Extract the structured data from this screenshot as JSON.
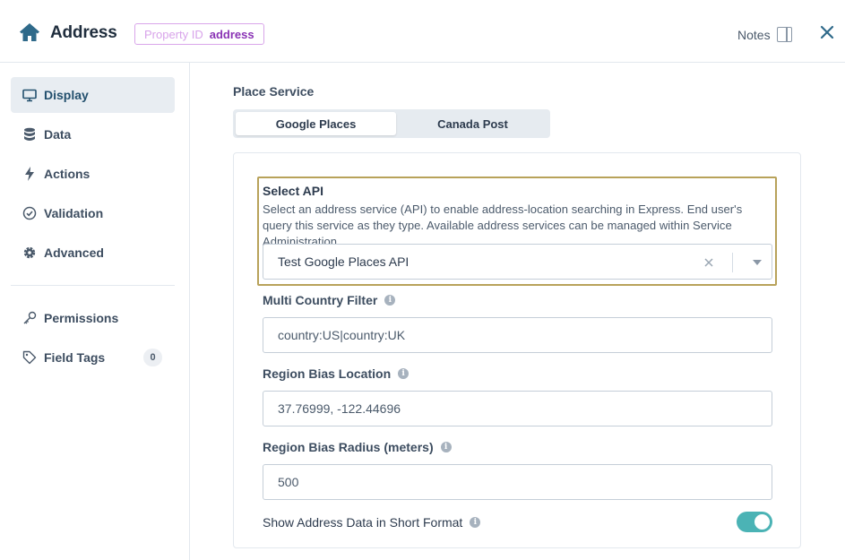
{
  "header": {
    "title": "Address",
    "property_id_label": "Property ID",
    "property_id_value": "address",
    "notes_label": "Notes"
  },
  "sidebar": {
    "items": [
      {
        "label": "Display",
        "icon": "monitor-icon",
        "active": true
      },
      {
        "label": "Data",
        "icon": "database-icon"
      },
      {
        "label": "Actions",
        "icon": "lightning-icon"
      },
      {
        "label": "Validation",
        "icon": "check-circle-icon"
      },
      {
        "label": "Advanced",
        "icon": "gear-icon"
      },
      {
        "label": "Permissions",
        "icon": "key-icon"
      },
      {
        "label": "Field Tags",
        "icon": "tag-icon",
        "count": "0"
      }
    ]
  },
  "main": {
    "place_service_label": "Place Service",
    "segments": [
      "Google Places",
      "Canada Post"
    ],
    "select_api": {
      "title": "Select API",
      "description": "Select an address service (API) to enable address-location searching in Express. End user's query this service as they type. Available address services can be managed within Service Administration.",
      "value": "Test Google Places API"
    },
    "multi_country_filter": {
      "label": "Multi Country Filter",
      "value": "country:US|country:UK"
    },
    "region_bias_location": {
      "label": "Region Bias Location",
      "value": "37.76999, -122.44696"
    },
    "region_bias_radius": {
      "label": "Region Bias Radius (meters)",
      "value": "500"
    },
    "short_format": {
      "label": "Show Address Data in Short Format",
      "enabled": true
    }
  },
  "colors": {
    "accent": "#4bb3b5",
    "highlight_border": "#b8a25a",
    "badge_value": "#8a34b5"
  }
}
